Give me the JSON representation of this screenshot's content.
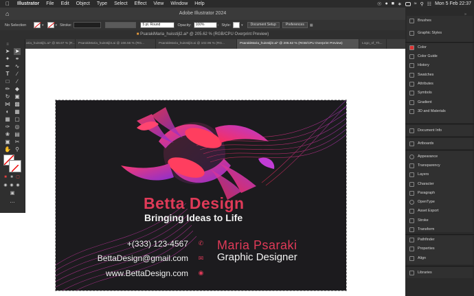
{
  "menubar": {
    "app": "Illustrator",
    "items": [
      "File",
      "Edit",
      "Object",
      "Type",
      "Select",
      "Effect",
      "View",
      "Window",
      "Help"
    ],
    "clock": "Mon 5 Feb 22:37"
  },
  "window": {
    "title": "Adobe Illustrator 2024"
  },
  "control": {
    "selection": "No Selection",
    "stroke_label": "Stroke:",
    "brush": "5 pt. Round",
    "opacity_label": "Opacity:",
    "opacity": "100%",
    "style_label": "Style:",
    "doc_setup": "Document Setup",
    "preferences": "Preferences"
  },
  "document": {
    "title": "PsarakiMaria_huisstijl2.ai* @ 205.62 % (RGB/CPU Overprint Preview)"
  },
  "tabs": [
    {
      "label": "aria_huisstijl1.ai* @ 66.67 % (R..."
    },
    {
      "label": "PsarakiMaria_huisstijl4.ai @ 166.56 % (RG..."
    },
    {
      "label": "PsarakiMaria_huisstijl3.ai @ 102.96 % (RG..."
    },
    {
      "label": "PsarakiMaria_huisstijl2.ai* @ 205.62 % (RGB/CPU Overprint Preview)"
    },
    {
      "label": "Logo_of_Th..."
    }
  ],
  "card": {
    "brand": "Betta Design",
    "tagline": "Bringing Ideas to Life",
    "phone": "+(333) 123-4567",
    "email": "BettaDesign@gmail.com",
    "website": "www.BettaDesign.com",
    "name": "Maria Psaraki",
    "role": "Graphic Designer",
    "accent": "#e03a58",
    "background": "#1c1b1e"
  },
  "panel": {
    "items": [
      {
        "label": "Brushes"
      },
      {
        "label": "Graphic Styles"
      },
      {
        "label": "Color"
      },
      {
        "label": "Color Guide"
      },
      {
        "label": "History"
      },
      {
        "label": "Swatches"
      },
      {
        "label": "Attributes"
      },
      {
        "label": "Symbols"
      },
      {
        "label": "Gradient"
      },
      {
        "label": "3D and Materials"
      },
      {
        "label": "Document Info"
      },
      {
        "label": "Artboards"
      },
      {
        "label": "Appearance"
      },
      {
        "label": "Transparency"
      },
      {
        "label": "Layers"
      },
      {
        "label": "Character"
      },
      {
        "label": "Paragraph"
      },
      {
        "label": "OpenType"
      },
      {
        "label": "Asset Export"
      },
      {
        "label": "Stroke"
      },
      {
        "label": "Transform"
      },
      {
        "label": "Pathfinder"
      },
      {
        "label": "Properties"
      },
      {
        "label": "Align"
      },
      {
        "label": "Libraries"
      }
    ]
  }
}
